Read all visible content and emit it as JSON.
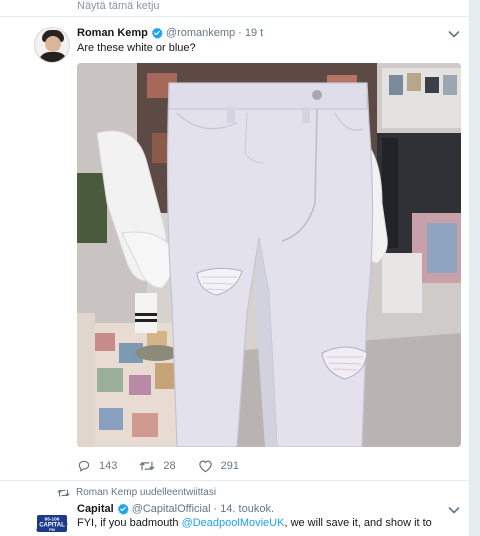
{
  "thread_link": "Näytä tämä ketju",
  "tweet1": {
    "name": "Roman Kemp",
    "handle": "@romankemp",
    "dot": "·",
    "time": "19 t",
    "text": "Are these white or blue?",
    "replies": "143",
    "retweets": "28",
    "likes": "291"
  },
  "retweet_context": "Roman Kemp uudelleentwiittasi",
  "tweet2": {
    "name": "Capital",
    "handle": "@CapitalOfficial",
    "dot": "·",
    "time": "14. toukok.",
    "text_prefix": "FYI, if you badmouth ",
    "mention": "@DeadpoolMovieUK",
    "text_suffix": ", we will save it, and show it to",
    "avatar_lines": [
      "95-106",
      "CAPITAL",
      "FM"
    ]
  },
  "colors": {
    "accent": "#1da1f2",
    "muted": "#657786",
    "capital_red": "#d0021b",
    "capital_blue": "#1a3a8a"
  },
  "icons": [
    "verified-icon",
    "caret-down-icon",
    "reply-icon",
    "retweet-icon",
    "like-icon"
  ]
}
